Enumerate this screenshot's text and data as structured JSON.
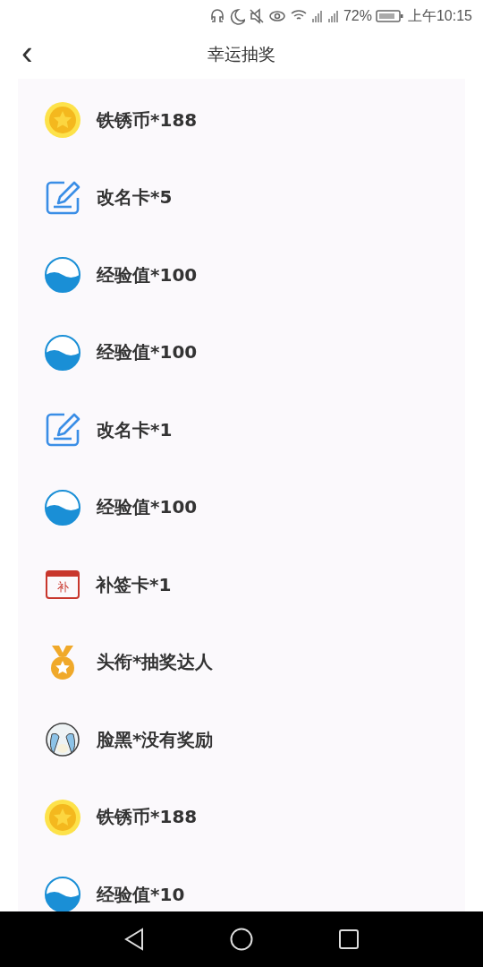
{
  "status_bar": {
    "battery": "72%",
    "time": "上午10:15"
  },
  "header": {
    "back": "‹",
    "title": "幸运抽奖"
  },
  "prizes": [
    {
      "kind": "coin",
      "label": "铁锈币*188"
    },
    {
      "kind": "rename",
      "label": "改名卡*5"
    },
    {
      "kind": "exp",
      "label": "经验值*100"
    },
    {
      "kind": "exp",
      "label": "经验值*100"
    },
    {
      "kind": "rename",
      "label": "改名卡*1"
    },
    {
      "kind": "exp",
      "label": "经验值*100"
    },
    {
      "kind": "calendar",
      "label": "补签卡*1",
      "icon_text": "补"
    },
    {
      "kind": "medal",
      "label": "头衔*抽奖达人"
    },
    {
      "kind": "crying",
      "label": "脸黑*没有奖励"
    },
    {
      "kind": "coin",
      "label": "铁锈币*188"
    },
    {
      "kind": "exp",
      "label": "经验值*10"
    }
  ]
}
